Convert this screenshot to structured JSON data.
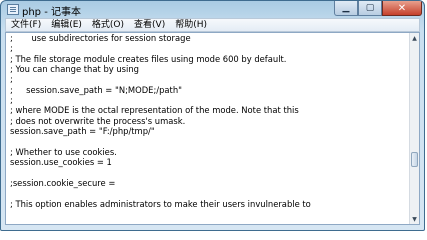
{
  "window": {
    "title": "php - 记事本"
  },
  "controls": {
    "minimize": "▁",
    "maximize": "▢",
    "close": "✕"
  },
  "menu": [
    "文件(F)",
    "编辑(E)",
    "格式(O)",
    "查看(V)",
    "帮助(H)"
  ],
  "editor": {
    "lines": [
      ";       use subdirectories for session storage",
      ";",
      "; The file storage module creates files using mode 600 by default.",
      "; You can change that by using",
      ";",
      ";     session.save_path = \"N;MODE;/path\"",
      ";",
      "; where MODE is the octal representation of the mode. Note that this",
      "; does not overwrite the process's umask.",
      "session.save_path = \"F:/php/tmp/\"",
      "",
      "; Whether to use cookies.",
      "session.use_cookies = 1",
      "",
      ";session.cookie_secure =",
      "",
      "; This option enables administrators to make their users invulnerable to",
      ""
    ]
  },
  "scrollbar": {
    "position_fraction": 0.7,
    "up_arrow": "▲",
    "down_arrow": "▼"
  }
}
